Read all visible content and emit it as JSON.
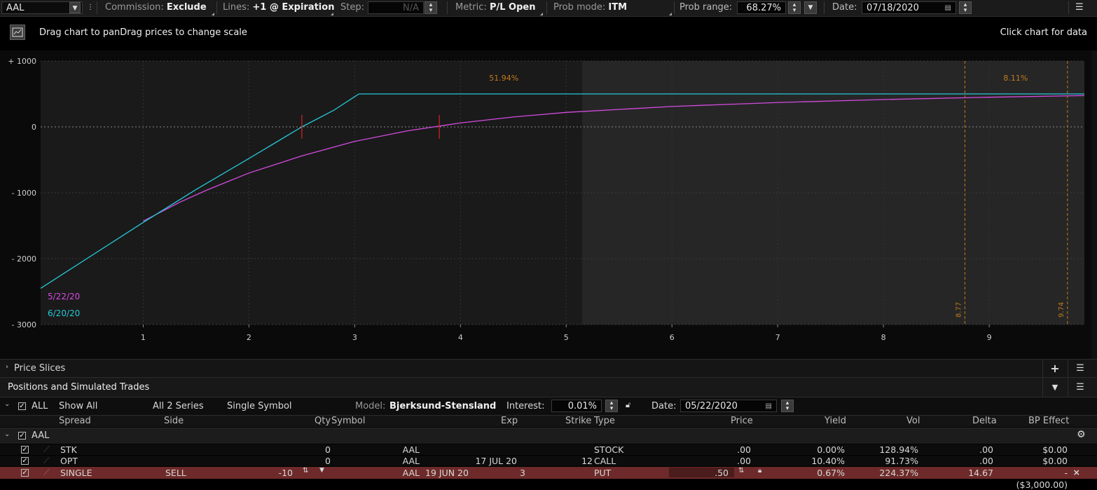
{
  "toolbar": {
    "symbol": "AAL",
    "commission_label": "Commission:",
    "commission_value": "Exclude",
    "lines_label": "Lines:",
    "lines_value": "+1 @ Expiration",
    "step_label": "Step:",
    "step_value": "N/A",
    "metric_label": "Metric:",
    "metric_value": "P/L Open",
    "probmode_label": "Prob mode:",
    "probmode_value": "ITM",
    "probrange_label": "Prob range:",
    "probrange_value": "68.27%",
    "date_label": "Date:",
    "date_value": "07/18/2020"
  },
  "header": {
    "hint": "Drag chart to panDrag prices to change scale",
    "right_hint": "Click chart for data"
  },
  "chart_data": {
    "type": "line",
    "x_ticks": [
      1,
      2,
      3,
      4,
      5,
      6,
      7,
      8,
      9
    ],
    "y_tick_labels": [
      "+ 1000",
      "0",
      "- 1000",
      "- 2000",
      "- 3000"
    ],
    "y_ticks": [
      1000,
      0,
      -1000,
      -2000,
      -3000
    ],
    "xlim": [
      0.03,
      9.9
    ],
    "ylim": [
      -3000,
      1000
    ],
    "grid": true,
    "series": [
      {
        "name": "5/22/20",
        "color": "#d44be0",
        "points": [
          [
            1.0,
            -1430
          ],
          [
            1.35,
            -1140
          ],
          [
            1.6,
            -960
          ],
          [
            2.0,
            -700
          ],
          [
            2.5,
            -440
          ],
          [
            3.0,
            -220
          ],
          [
            3.5,
            -60
          ],
          [
            4.0,
            60
          ],
          [
            4.5,
            150
          ],
          [
            5.0,
            220
          ],
          [
            6.0,
            310
          ],
          [
            7.0,
            370
          ],
          [
            8.0,
            415
          ],
          [
            9.0,
            450
          ],
          [
            9.9,
            475
          ]
        ]
      },
      {
        "name": "6/20/20",
        "color": "#26c8d6",
        "points": [
          [
            0.03,
            -2450
          ],
          [
            1.0,
            -1450
          ],
          [
            1.5,
            -950
          ],
          [
            2.0,
            -480
          ],
          [
            2.5,
            0
          ],
          [
            2.8,
            250
          ],
          [
            3.04,
            500
          ],
          [
            9.9,
            500
          ]
        ]
      }
    ],
    "annotations": {
      "prob_left": "51.94%",
      "prob_right": "8.11%",
      "vline_1": "8.77",
      "vline_2": "9.74",
      "shade_end_x": 5.15,
      "breakeven_x": [
        2.5,
        3.8
      ]
    }
  },
  "price_slices": {
    "label": "Price Slices"
  },
  "positions": {
    "title": "Positions and Simulated Trades",
    "filter_all": "ALL",
    "show_all": "Show All",
    "all_series": "All 2 Series",
    "single_symbol": "Single Symbol",
    "model_label": "Model:",
    "model_value": "Bjerksund-Stensland",
    "interest_label": "Interest:",
    "interest_value": "0.01%",
    "date_label": "Date:",
    "date_value": "05/22/2020",
    "columns": [
      "Spread",
      "Side",
      "Qty",
      "Symbol",
      "Exp",
      "Strike",
      "Type",
      "Price",
      "Yield",
      "Vol",
      "Delta",
      "BP Effect"
    ],
    "group": "AAL",
    "rows": [
      {
        "spread": "STK",
        "side": "",
        "qty": "0",
        "symbol": "AAL",
        "exp": "",
        "strike": "",
        "type": "STOCK",
        "price": ".00",
        "yield": "0.00%",
        "vol": "128.94%",
        "delta": ".00",
        "bp": "$0.00"
      },
      {
        "spread": "OPT",
        "side": "",
        "qty": "0",
        "symbol": "AAL",
        "exp": "17 JUL 20",
        "strike": "12",
        "type": "CALL",
        "price": ".00",
        "yield": "10.40%",
        "vol": "91.73%",
        "delta": ".00",
        "bp": "$0.00"
      },
      {
        "spread": "SINGLE",
        "side": "SELL",
        "qty": "-10",
        "symbol": "AAL",
        "exp": "19 JUN 20",
        "strike": "3",
        "type": "PUT",
        "price": ".50",
        "yield": "0.67%",
        "vol": "224.37%",
        "delta": "14.67",
        "bp": "-"
      }
    ],
    "total_bp": "($3,000.00)"
  }
}
